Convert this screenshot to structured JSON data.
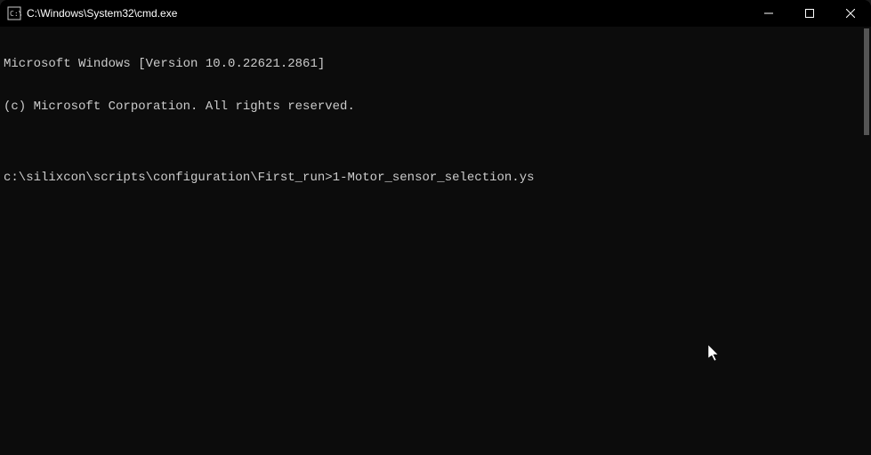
{
  "window": {
    "title": "C:\\Windows\\System32\\cmd.exe"
  },
  "terminal": {
    "line1": "Microsoft Windows [Version 10.0.22621.2861]",
    "line2": "(c) Microsoft Corporation. All rights reserved.",
    "blank": "",
    "prompt": "c:\\silixcon\\scripts\\configuration\\First_run>",
    "command": "1-Motor_sensor_selection.ys"
  }
}
